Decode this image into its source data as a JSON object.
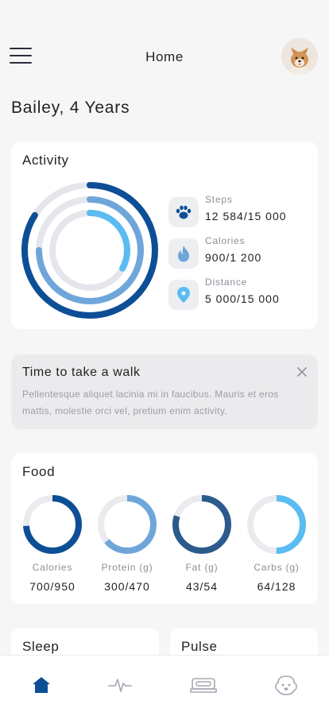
{
  "header": {
    "title": "Home"
  },
  "pet": {
    "title": "Bailey, 4 Years"
  },
  "activity": {
    "title": "Activity",
    "stats": [
      {
        "label": "Steps",
        "value": "12 584/15 000",
        "icon": "paw-icon",
        "progress": 0.84
      },
      {
        "label": "Calories",
        "value": "900/1 200",
        "icon": "flame-icon",
        "progress": 0.75
      },
      {
        "label": "Distance",
        "value": "5 000/15 000",
        "icon": "location-pin-icon",
        "progress": 0.33
      }
    ]
  },
  "notice": {
    "title": "Time to take a walk",
    "body": "Pellentesque aliquet lacinia mi in faucibus. Mauris et eros mattis, molestie orci vel, pretium enim activity."
  },
  "food": {
    "title": "Food",
    "items": [
      {
        "label": "Calories",
        "value": "700/950",
        "progress": 0.74,
        "color": "#0d4f96"
      },
      {
        "label": "Protein (g)",
        "value": "300/470",
        "progress": 0.64,
        "color": "#6fa6da"
      },
      {
        "label": "Fat (g)",
        "value": "43/54",
        "progress": 0.8,
        "color": "#2c5a8c"
      },
      {
        "label": "Carbs (g)",
        "value": "64/128",
        "progress": 0.5,
        "color": "#5bbcf2"
      }
    ]
  },
  "cards": {
    "sleep": "Sleep",
    "pulse": "Pulse"
  },
  "tabs": [
    {
      "name": "home-icon",
      "active": true
    },
    {
      "name": "pulse-icon",
      "active": false
    },
    {
      "name": "bed-icon",
      "active": false
    },
    {
      "name": "dog-face-icon",
      "active": false
    }
  ],
  "colors": {
    "primary": "#0d4f96",
    "ring_track": "#e5e6ec",
    "ring_outer": "#0d4f96",
    "ring_middle": "#6fa6da",
    "ring_inner": "#5bbcf2",
    "background": "#f6f6f7"
  }
}
